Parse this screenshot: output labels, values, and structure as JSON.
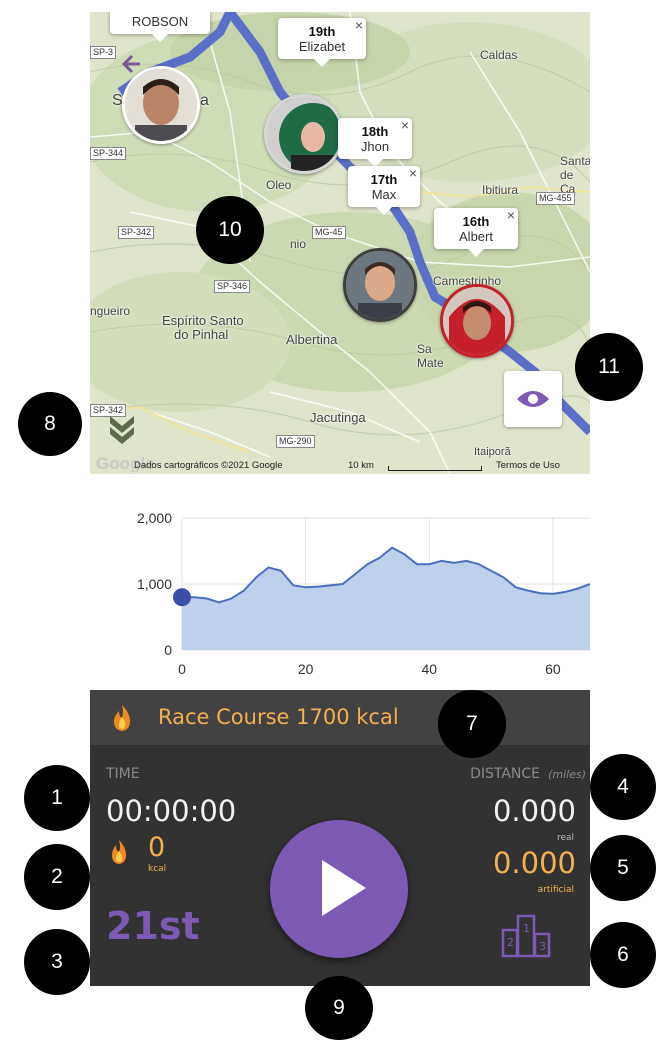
{
  "colors": {
    "accent_purple": "#7c5ab3",
    "orange": "#f4b04f",
    "panel_bg": "#323232",
    "header_bg": "#424242",
    "route_blue": "#5b6fc9",
    "chart_fill": "#bfd0ec",
    "chart_line": "#4a6fc0"
  },
  "map": {
    "places": [
      "ROBSON",
      "Caldas",
      "Oleo",
      "Ibitiura",
      "Espírito Santo",
      "do Pinhal",
      "Albertina",
      "Jacutinga",
      "Itaiporã",
      "Sa",
      "Mate",
      "Camestrinho",
      "ngueiro",
      "Santa",
      "de Ca",
      "nio",
      "Sã",
      "a"
    ],
    "roads": [
      "SP-344",
      "SP-342",
      "SP-346",
      "MG-455",
      "MG-45",
      "MG-290",
      "SP-342",
      "SP-3"
    ],
    "racers": [
      {
        "rank": "19th",
        "name": "Elizabet",
        "close": "×"
      },
      {
        "rank": "18th",
        "name": "Jhon",
        "close": "×"
      },
      {
        "rank": "17th",
        "name": "Max",
        "close": "×"
      },
      {
        "rank": "16th",
        "name": "Albert",
        "close": "×"
      }
    ],
    "attribution_left": "Google",
    "attribution_data": "Dados cartográficos ©2021 Google",
    "scale": "10 km",
    "terms": "Termos de Uso",
    "icons": {
      "collapse": "double-chevron-down-icon",
      "eye": "eye-icon",
      "back": "back-arrow-icon"
    }
  },
  "chart_data": {
    "type": "area",
    "x": [
      0,
      2,
      4,
      6,
      8,
      10,
      12,
      14,
      16,
      18,
      20,
      22,
      24,
      26,
      28,
      30,
      32,
      34,
      36,
      38,
      40,
      42,
      44,
      46,
      48,
      50,
      52,
      54,
      56,
      58,
      60,
      62,
      64,
      66
    ],
    "y": [
      800,
      800,
      780,
      720,
      780,
      900,
      1100,
      1250,
      1200,
      980,
      950,
      960,
      980,
      1000,
      1150,
      1300,
      1400,
      1550,
      1450,
      1300,
      1300,
      1350,
      1320,
      1350,
      1300,
      1200,
      1100,
      950,
      900,
      860,
      850,
      880,
      930,
      1000
    ],
    "xticks": [
      "0",
      "20",
      "40",
      "60"
    ],
    "yticks": [
      "0",
      "1,000",
      "2,000"
    ],
    "xlim": [
      0,
      66
    ],
    "ylim": [
      0,
      2000
    ],
    "grid": true,
    "marker_point": [
      0,
      800
    ]
  },
  "panel": {
    "title": "Race Course 1700 kcal",
    "time_label": "TIME",
    "time_value": "00:00:00",
    "kcal_value": "0",
    "kcal_unit": "kcal",
    "rank": "21st",
    "distance_label": "DISTANCE",
    "distance_unit": "(miles)",
    "real_value": "0.000",
    "real_label": "real",
    "artificial_value": "0.000",
    "artificial_label": "artificial",
    "ranks_icon": "podium-icon"
  },
  "markers": [
    "1",
    "2",
    "3",
    "4",
    "5",
    "6",
    "7",
    "8",
    "9",
    "10",
    "11"
  ]
}
